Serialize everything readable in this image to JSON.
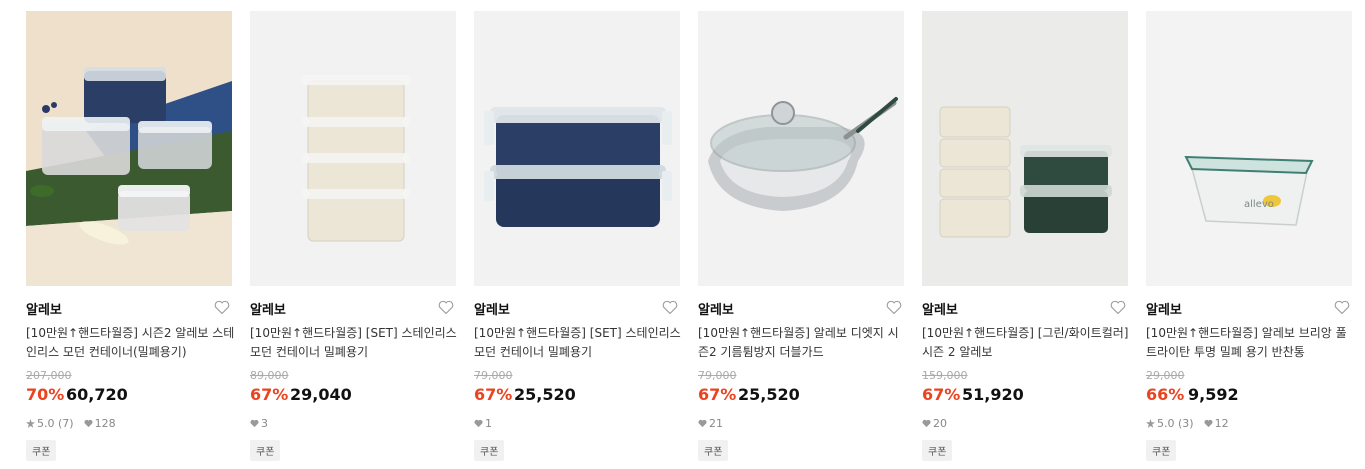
{
  "products": [
    {
      "brand": "알레보",
      "title": "[10만원↑핸드타월증] 시즌2 알레보 스테인리스 모던 컨테이너(밀폐용기)",
      "original_price": "207,000",
      "discount": "70%",
      "price": "60,720",
      "rating": "5.0 (7)",
      "likes": "128",
      "coupon": "쿠폰"
    },
    {
      "brand": "알레보",
      "title": "[10만원↑핸드타월증] [SET] 스테인리스 모던 컨테이너 밀폐용기",
      "original_price": "89,000",
      "discount": "67%",
      "price": "29,040",
      "rating": "",
      "likes": "3",
      "coupon": "쿠폰"
    },
    {
      "brand": "알레보",
      "title": "[10만원↑핸드타월증] [SET] 스테인리스 모던 컨테이너 밀폐용기",
      "original_price": "79,000",
      "discount": "67%",
      "price": "25,520",
      "rating": "",
      "likes": "1",
      "coupon": "쿠폰"
    },
    {
      "brand": "알레보",
      "title": "[10만원↑핸드타월증] 알레보 디엣지 시즌2 기름튐방지 더블가드",
      "original_price": "79,000",
      "discount": "67%",
      "price": "25,520",
      "rating": "",
      "likes": "21",
      "coupon": "쿠폰"
    },
    {
      "brand": "알레보",
      "title": "[10만원↑핸드타월증] [그린/화이트컬러] 시즌 2 알레보",
      "original_price": "159,000",
      "discount": "67%",
      "price": "51,920",
      "rating": "",
      "likes": "20",
      "coupon": "쿠폰"
    },
    {
      "brand": "알레보",
      "title": "[10만원↑핸드타월증] 알레보 브리앙 풀 트라이탄 투명 밀폐 용기 반찬통",
      "original_price": "29,000",
      "discount": "66%",
      "price": "9,592",
      "rating": "5.0 (3)",
      "likes": "12",
      "coupon": "쿠폰"
    }
  ],
  "icons": {
    "wishlist": "heart-outline-icon",
    "rating": "star-icon",
    "likes": "heart-filled-icon"
  },
  "colors": {
    "discount": "#e8441f",
    "navy_container": "#2b3f66",
    "green_container": "#2f4a3e"
  }
}
